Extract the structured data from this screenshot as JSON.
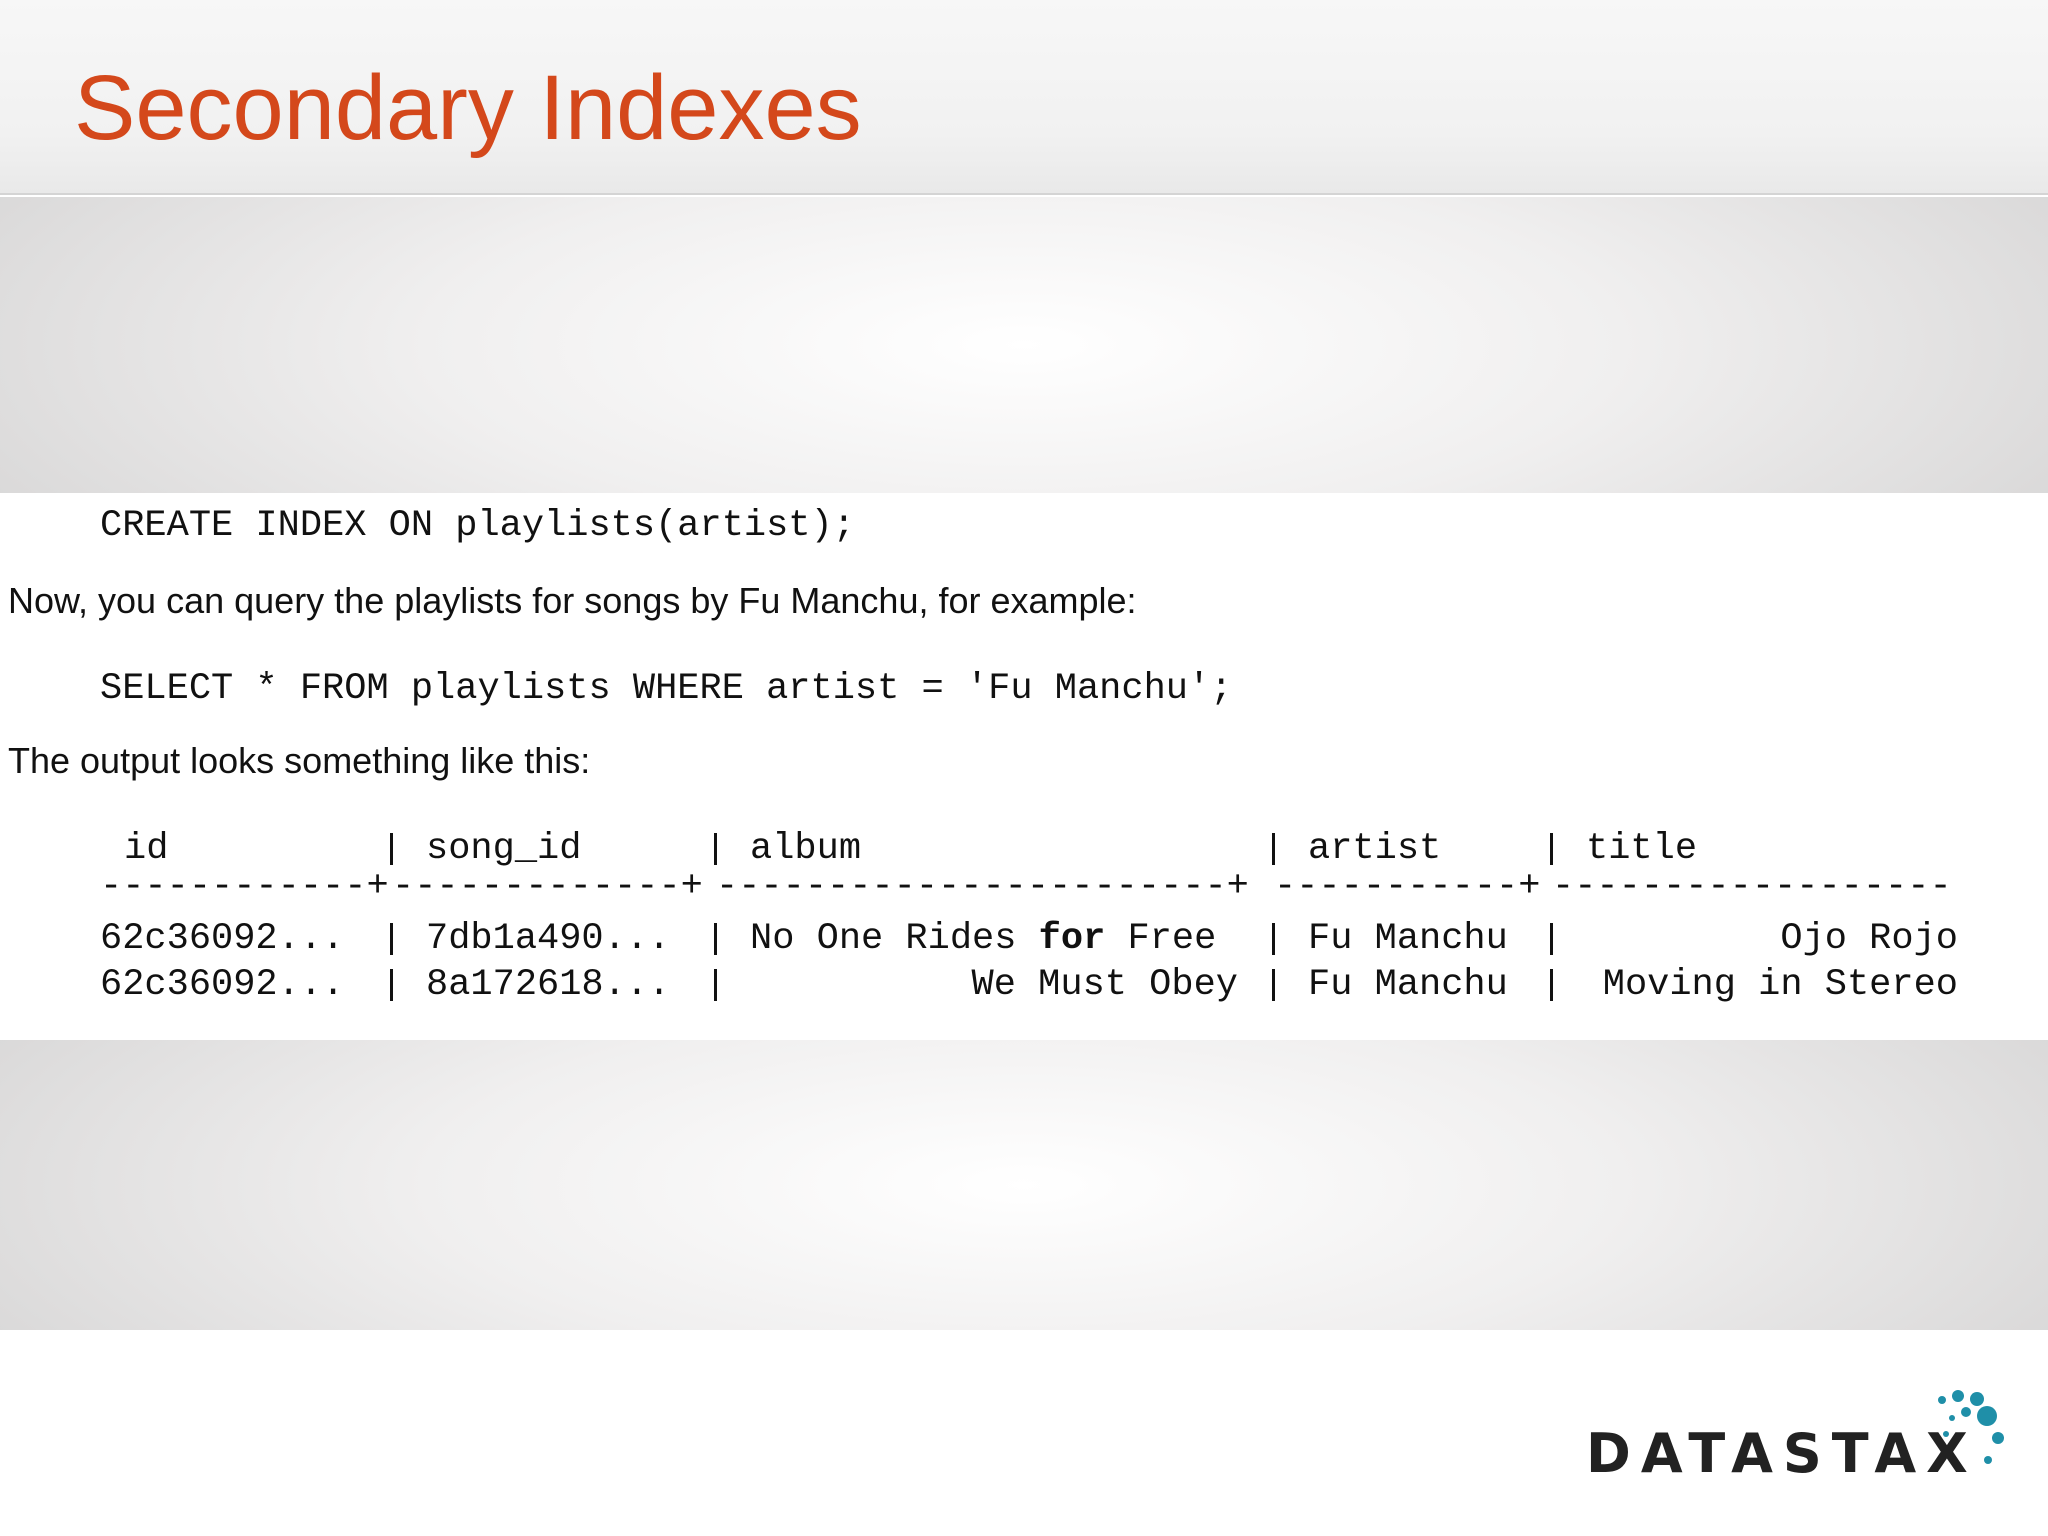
{
  "slide": {
    "title": "Secondary Indexes"
  },
  "content": {
    "code1": "CREATE INDEX ON playlists(artist);",
    "prose1": "Now, you can query the playlists for songs by Fu Manchu, for example:",
    "code2": "SELECT * FROM playlists WHERE artist = 'Fu Manchu';",
    "prose2": "The output looks something like this:"
  },
  "output_table": {
    "headers": [
      "id",
      "song_id",
      "album",
      "artist",
      "title"
    ],
    "rule_segments": [
      "------------+",
      "-------------+",
      "-----------------------+",
      "-----------+",
      "------------------"
    ],
    "rows": [
      {
        "id": "62c36092...",
        "song_id": "7db1a490...",
        "album_pre": "No One Rides ",
        "album_kw": "for",
        "album_post": " Free",
        "artist": "Fu Manchu",
        "title": "Ojo Rojo"
      },
      {
        "id": "62c36092...",
        "song_id": "8a172618...",
        "album_pre": "We Must Obey",
        "album_kw": "",
        "album_post": "",
        "artist": "Fu Manchu",
        "title": "Moving in Stereo"
      }
    ]
  },
  "logo": {
    "text": "DATASTAX",
    "dot_color": "#1f8fa8",
    "text_color": "#222222"
  },
  "colors": {
    "title": "#d4481b",
    "text": "#111111"
  }
}
